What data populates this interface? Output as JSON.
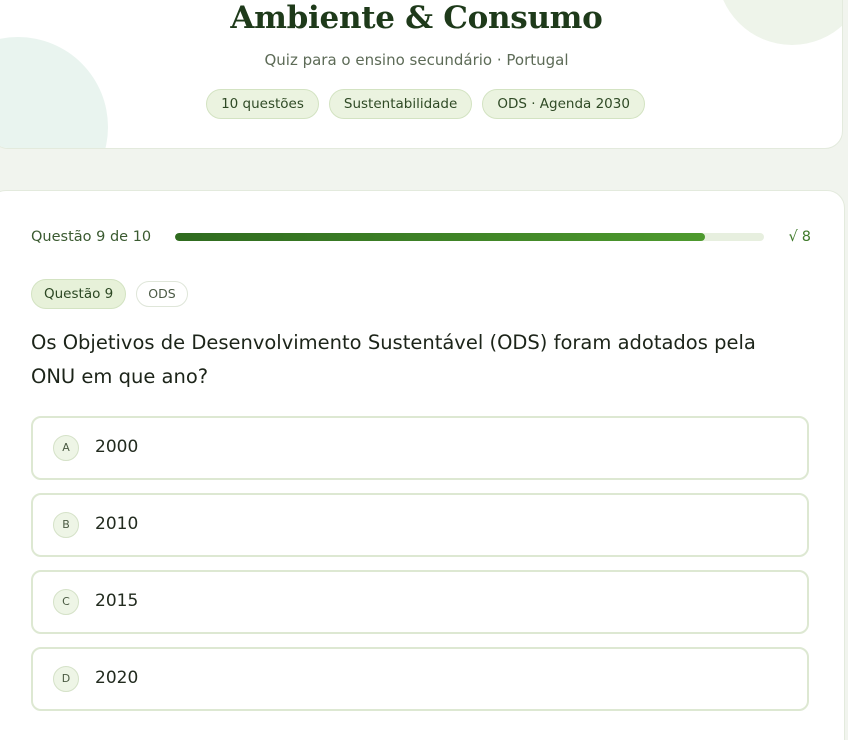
{
  "header": {
    "title": "Ambiente & Consumo",
    "subtitle": "Quiz para o ensino secundário · Portugal",
    "tags": [
      "10 questões",
      "Sustentabilidade",
      "ODS · Agenda 2030"
    ]
  },
  "progress": {
    "label": "Questão 9 de 10",
    "fraction": 0.9,
    "score_check": "√",
    "score_value": "8"
  },
  "question": {
    "badge": "Questão 9",
    "topic": "ODS",
    "text": "Os Objetivos de Desenvolvimento Sustentável (ODS) foram adotados pela ONU em que ano?",
    "options": [
      {
        "letter": "A",
        "text": "2000"
      },
      {
        "letter": "B",
        "text": "2010"
      },
      {
        "letter": "C",
        "text": "2015"
      },
      {
        "letter": "D",
        "text": "2020"
      }
    ]
  },
  "colors": {
    "accent": "#3f7a2a",
    "progress_fill": "#2f6b1f",
    "tag_bg": "#ebf3e0"
  }
}
